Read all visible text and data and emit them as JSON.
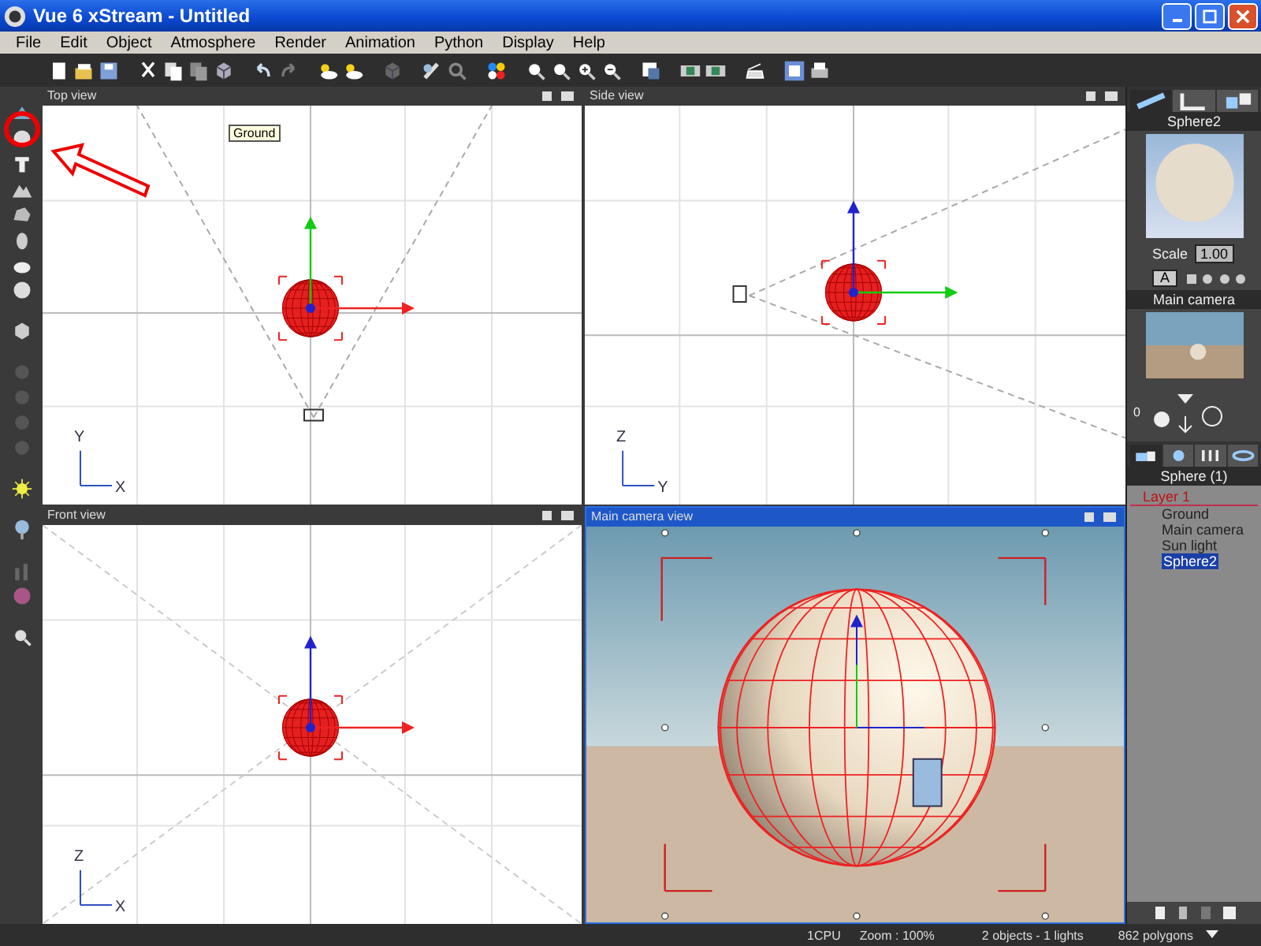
{
  "window": {
    "title": "Vue 6 xStream - Untitled"
  },
  "menu": [
    "File",
    "Edit",
    "Object",
    "Atmosphere",
    "Render",
    "Animation",
    "Python",
    "Display",
    "Help"
  ],
  "viewports": [
    {
      "kind": "top",
      "title": "Top view",
      "selected": false,
      "tag": "Ground",
      "axis_v": "Y",
      "axis_h": "X"
    },
    {
      "kind": "side",
      "title": "Side view",
      "selected": false,
      "axis_v": "Z",
      "axis_h": "Y"
    },
    {
      "kind": "front",
      "title": "Front view",
      "selected": false,
      "axis_v": "Z",
      "axis_h": "X"
    },
    {
      "kind": "camera",
      "title": "Main camera view",
      "selected": true
    }
  ],
  "object_panel": {
    "title": "Sphere2",
    "scale_label": "Scale",
    "scale_value": "1.00",
    "material_button": "A"
  },
  "camera_panel": {
    "title": "Main camera",
    "frame": "0"
  },
  "layers_panel": {
    "title": "Sphere (1)",
    "tree": [
      {
        "label": "Layer 1",
        "selected": false,
        "children": [
          {
            "label": "Ground",
            "selected": false
          },
          {
            "label": "Main camera",
            "selected": false
          },
          {
            "label": "Sun light",
            "selected": false
          },
          {
            "label": "Sphere2",
            "selected": true
          }
        ]
      }
    ]
  },
  "status_bar": {
    "cpu": "1CPU",
    "zoom": "Zoom : 100%",
    "counts": "2 objects - 1 lights",
    "polygons": "862 polygons"
  }
}
